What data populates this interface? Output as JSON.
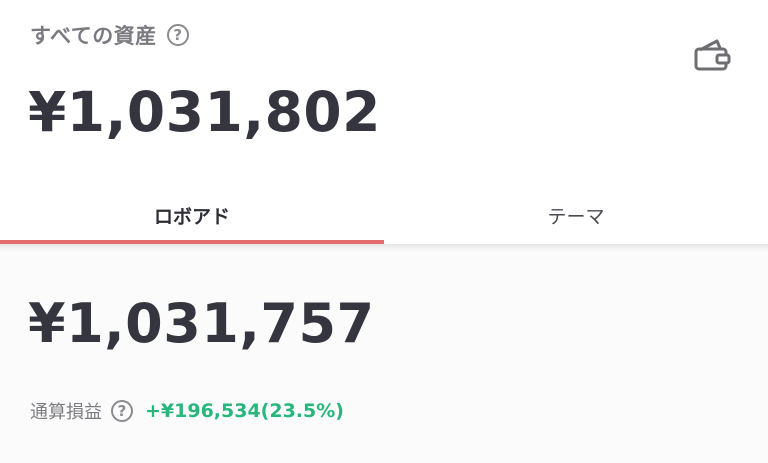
{
  "header": {
    "title": "すべての資産",
    "help_glyph": "?",
    "wallet_icon": "wallet-icon",
    "total_assets": "¥1,031,802"
  },
  "tabs": [
    {
      "label": "ロボアド",
      "active": true
    },
    {
      "label": "テーマ",
      "active": false
    }
  ],
  "robo_advisor": {
    "total": "¥1,031,757",
    "profit_loss_label": "通算損益",
    "help_glyph": "?",
    "profit_loss_value": "+¥196,534(23.5%)"
  },
  "colors": {
    "accent": "#e26b6c",
    "profit": "#27b67c",
    "text_primary": "#35353f",
    "text_secondary": "#7a7a80"
  }
}
